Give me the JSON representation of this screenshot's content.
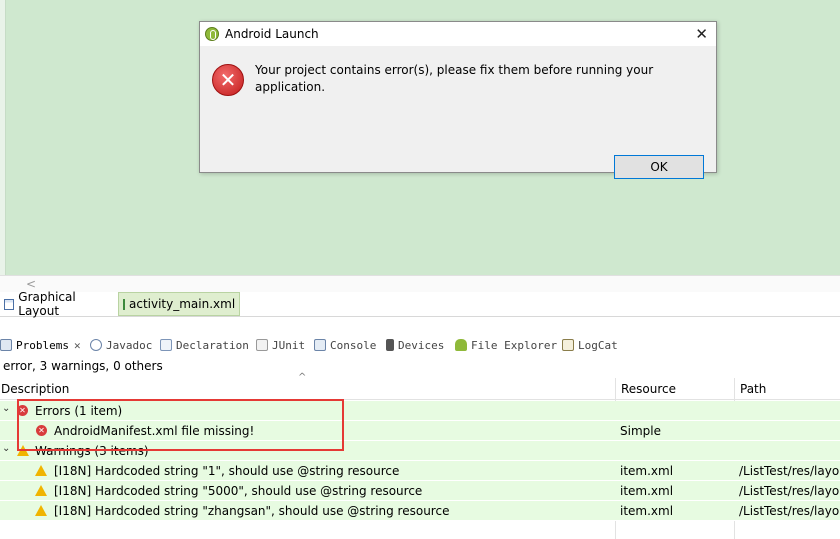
{
  "dialog": {
    "title": "Android Launch",
    "message": "Your project contains error(s), please fix them before running your application.",
    "ok_label": "OK",
    "close_glyph": "✕",
    "error_glyph": "✕"
  },
  "editor_tabs": [
    {
      "label": "Graphical Layout",
      "icon": "layout-icon"
    },
    {
      "label": "activity_main.xml",
      "icon": "xml-file-icon"
    }
  ],
  "scroll": {
    "left_arrow": "<"
  },
  "views": [
    {
      "label": "Problems",
      "icon": "problems-icon",
      "active": true,
      "close": "✕"
    },
    {
      "label": "Javadoc",
      "icon": "javadoc-icon"
    },
    {
      "label": "Declaration",
      "icon": "declaration-icon"
    },
    {
      "label": "JUnit",
      "icon": "junit-icon"
    },
    {
      "label": "Console",
      "icon": "console-icon"
    },
    {
      "label": "Devices",
      "icon": "devices-icon"
    },
    {
      "label": "File Explorer",
      "icon": "android-icon"
    },
    {
      "label": "LogCat",
      "icon": "logcat-icon"
    }
  ],
  "summary": "error, 3 warnings, 0 others",
  "table": {
    "sort_caret": "^",
    "columns": [
      "Description",
      "Resource",
      "Path"
    ],
    "rows": [
      {
        "level": 0,
        "toggle": "⌄",
        "type": "error",
        "description": "Errors (1 item)",
        "resource": "",
        "path": ""
      },
      {
        "level": 1,
        "toggle": "",
        "type": "error",
        "description": "AndroidManifest.xml file missing!",
        "resource": "Simple",
        "path": ""
      },
      {
        "level": 0,
        "toggle": "⌄",
        "type": "warning",
        "description": "Warnings (3 items)",
        "resource": "",
        "path": ""
      },
      {
        "level": 1,
        "toggle": "",
        "type": "warning",
        "description": "[I18N] Hardcoded string \"1\", should use @string resource",
        "resource": "item.xml",
        "path": "/ListTest/res/layo"
      },
      {
        "level": 1,
        "toggle": "",
        "type": "warning",
        "description": "[I18N] Hardcoded string \"5000\", should use @string resource",
        "resource": "item.xml",
        "path": "/ListTest/res/layo"
      },
      {
        "level": 1,
        "toggle": "",
        "type": "warning",
        "description": "[I18N] Hardcoded string \"zhangsan\", should use @string resource",
        "resource": "item.xml",
        "path": "/ListTest/res/layo"
      }
    ]
  },
  "colors": {
    "canvas": "#cfe8cf",
    "row_bg": "#e7fbe1",
    "highlight": "#e53935",
    "error": "#d83c3c",
    "warning": "#f0b400"
  }
}
